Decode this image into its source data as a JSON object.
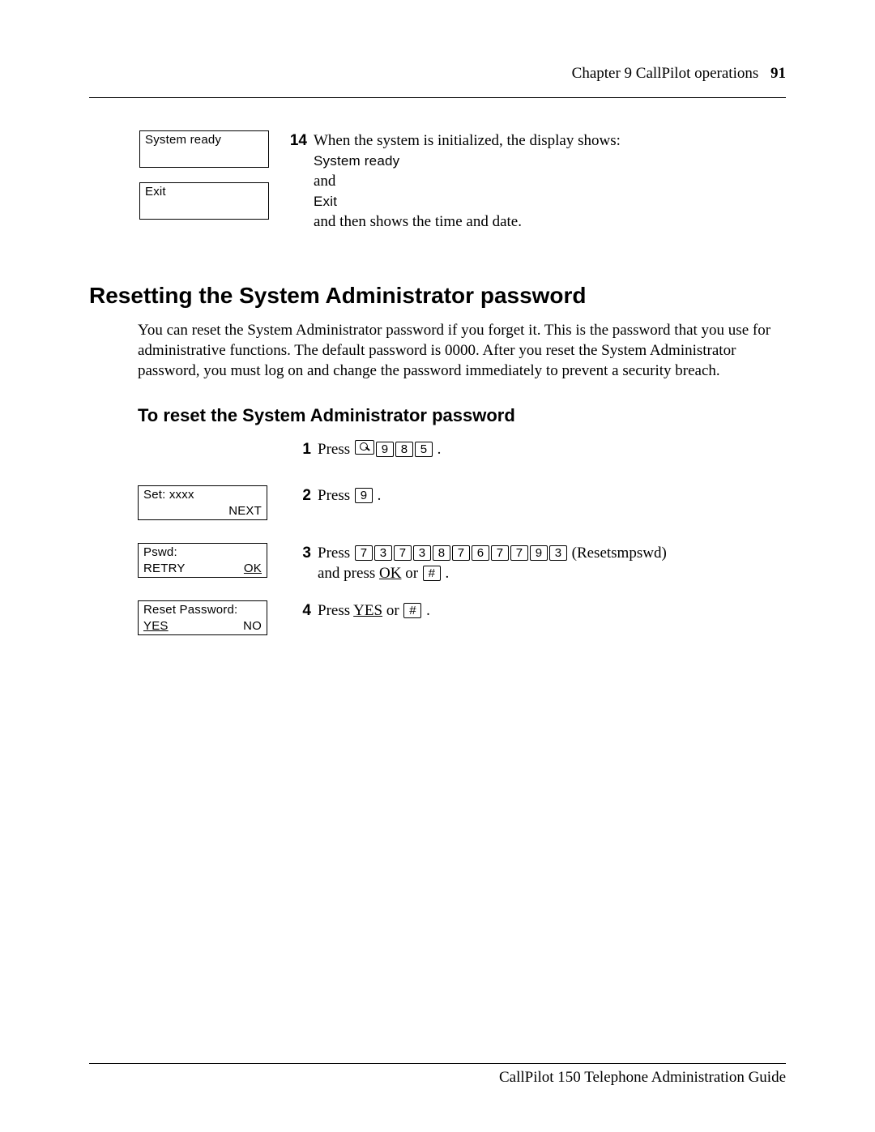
{
  "header": {
    "chapter": "Chapter 9  CallPilot operations",
    "page_number": "91"
  },
  "step14": {
    "display1": "System ready",
    "display2": "Exit",
    "num": "14",
    "text_before": "When the system is initialized, the display shows:",
    "lcd1": "System ready",
    "and1": "and",
    "lcd2": "Exit",
    "text_after": "and then shows the time and date."
  },
  "section": {
    "heading": "Resetting the System Administrator password",
    "body": "You can reset the System Administrator password if you forget it. This is the password that you use for administrative functions. The default password is 0000. After you reset the System Administrator password, you must log on and change the password immediately to prevent a security breach.",
    "subheading": "To reset the System Administrator password"
  },
  "steps": {
    "s1": {
      "num": "1",
      "press": "Press ",
      "keys": [
        "9",
        "8",
        "5"
      ],
      "period": " ."
    },
    "s2": {
      "num": "2",
      "display_line1": "Set: xxxx",
      "sk_right": "NEXT",
      "press": "Press ",
      "keys": [
        "9"
      ],
      "period": " ."
    },
    "s3": {
      "num": "3",
      "display_line1": "Pswd:",
      "sk_left": "RETRY",
      "sk_right": "OK",
      "press": "Press ",
      "keys": [
        "7",
        "3",
        "7",
        "3",
        "8",
        "7",
        "6",
        "7",
        "7",
        "9",
        "3"
      ],
      "paren": "  (Resetsmpswd)",
      "line2a": "and press ",
      "ok": "OK",
      "line2b": " or ",
      "hash": "#",
      "period": " ."
    },
    "s4": {
      "num": "4",
      "display_line1": "Reset Password:",
      "sk_left": "YES",
      "sk_right": "NO",
      "press": "Press ",
      "yes": "YES",
      "or": " or ",
      "hash": "#",
      "period": " ."
    }
  },
  "footer": {
    "text": "CallPilot 150 Telephone Administration Guide"
  }
}
